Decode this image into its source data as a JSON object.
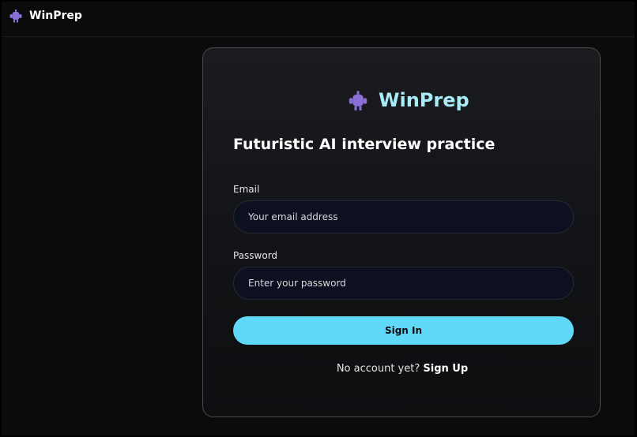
{
  "app": {
    "name": "WinPrep",
    "logo_icon": "robot-icon",
    "logo_color": "#8a6fd6"
  },
  "card": {
    "brand": "WinPrep",
    "heading": "Futuristic AI interview practice",
    "email": {
      "label": "Email",
      "placeholder": "Your email address",
      "value": ""
    },
    "password": {
      "label": "Password",
      "placeholder": "Enter your password",
      "value": ""
    },
    "submit_label": "Sign In",
    "signup_prompt": "No account yet?",
    "signup_link": "Sign Up"
  },
  "colors": {
    "accent": "#60d8f8",
    "brand_text": "#a8ecf8",
    "background": "#0b0b0c"
  }
}
